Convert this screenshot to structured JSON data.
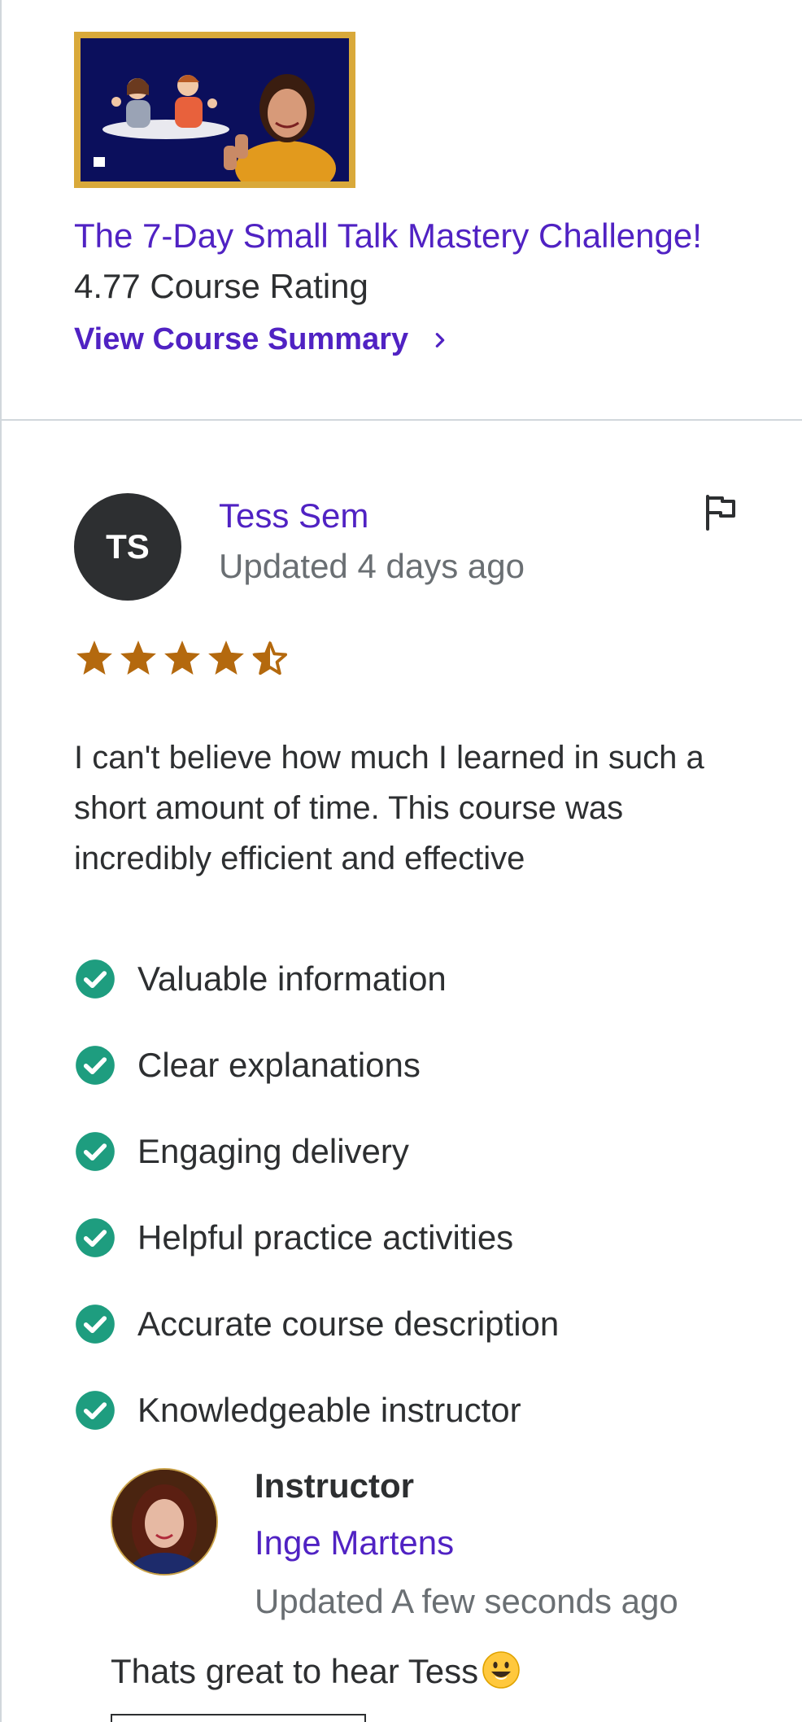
{
  "course": {
    "title": "The 7-Day Small Talk Mastery Challenge!",
    "rating": "4.77 Course Rating",
    "summary_link": "View Course Summary"
  },
  "review": {
    "avatar_initials": "TS",
    "reviewer_name": "Tess Sem",
    "updated": "Updated 4 days ago",
    "rating": 4.5,
    "text": "I can't believe how much I learned in such a short amount of time. This course was incredibly efficient and effective",
    "tags": [
      "Valuable information",
      "Clear explanations",
      "Engaging delivery",
      "Helpful practice activities",
      "Accurate course description",
      "Knowledgeable instructor"
    ]
  },
  "response": {
    "label": "Instructor",
    "name": "Inge Martens",
    "updated": "Updated A few seconds ago",
    "text": "Thats great to hear Tess"
  },
  "colors": {
    "link_purple": "#5022c3",
    "star": "#b4690e",
    "check": "#1e9d7f",
    "muted": "#6a6f73"
  },
  "icons": {
    "flag": "flag-icon",
    "check": "check-circle-icon",
    "chevron": "chevron-right-icon",
    "star": "star-icon",
    "emoji": "smiley-emoji"
  }
}
